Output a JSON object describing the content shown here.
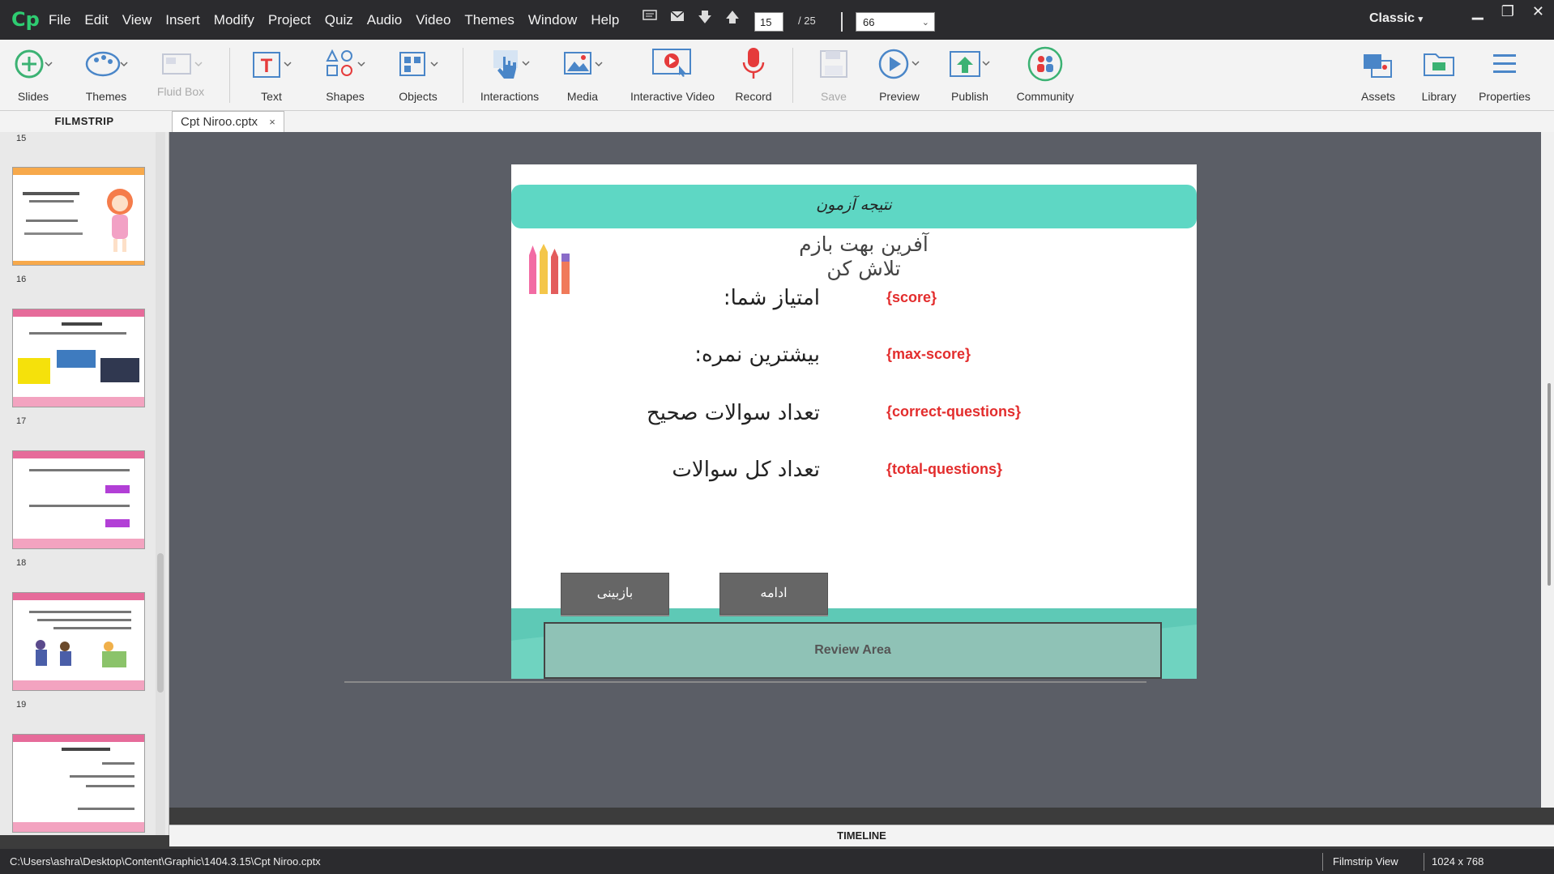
{
  "app": {
    "logo": "Cp",
    "workspace": "Classic"
  },
  "menu": [
    "File",
    "Edit",
    "View",
    "Insert",
    "Modify",
    "Project",
    "Quiz",
    "Audio",
    "Video",
    "Themes",
    "Window",
    "Help"
  ],
  "nav": {
    "current_page": "15",
    "total_pages": "/ 25",
    "zoom": "66"
  },
  "toolbar": {
    "slides": "Slides",
    "themes": "Themes",
    "fluid_box": "Fluid Box",
    "text": "Text",
    "shapes": "Shapes",
    "objects": "Objects",
    "interactions": "Interactions",
    "media": "Media",
    "interactive_video": "Interactive Video",
    "record": "Record",
    "save": "Save",
    "preview": "Preview",
    "publish": "Publish",
    "community": "Community",
    "assets": "Assets",
    "library": "Library",
    "properties": "Properties"
  },
  "filmstrip": {
    "title": "FILMSTRIP",
    "top_partial_number": "15",
    "slides": [
      {
        "number": "16",
        "accent": "#f7a94b"
      },
      {
        "number": "17",
        "accent": "#e66b9a"
      },
      {
        "number": "18",
        "accent": "#e66b9a"
      },
      {
        "number": "19",
        "accent": "#e66b9a"
      },
      {
        "number": "",
        "accent": "#e66b9a"
      }
    ]
  },
  "tab": {
    "label": "Cpt Niroo.cptx",
    "close": "×"
  },
  "slide": {
    "title": "نتیجه آزمون",
    "greeting_line1": "آفرین بهت بازم",
    "greeting_line2": "تلاش کن",
    "rows": [
      {
        "label": ":امتیاز شما",
        "var": "{score}"
      },
      {
        "label": ":بیشترین نمره",
        "var": "{max-score}"
      },
      {
        "label": "تعداد سوالات صحیح",
        "var": "{correct-questions}"
      },
      {
        "label": "تعداد کل سوالات",
        "var": "{total-questions}"
      }
    ],
    "review_button": "بازبینی",
    "continue_button": "ادامه",
    "review_area": "Review Area",
    "colors": {
      "title_bar": "#5ed7c4",
      "variable": "#e32d2d",
      "footer": "#5ec9b6"
    }
  },
  "timeline": {
    "label": "TIMELINE"
  },
  "status": {
    "path": "C:\\Users\\ashra\\Desktop\\Content\\Graphic\\1404.3.15\\Cpt Niroo.cptx",
    "view": "Filmstrip View",
    "resolution": "1024 x 768"
  }
}
